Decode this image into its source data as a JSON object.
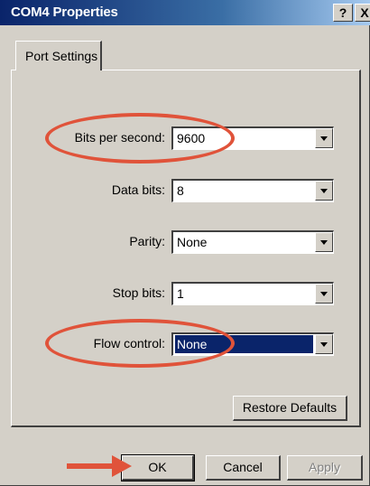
{
  "window": {
    "title": "COM4 Properties",
    "help_button": "?",
    "close_button": "X"
  },
  "tabs": [
    {
      "label": "Port Settings"
    }
  ],
  "settings": {
    "bits_per_second": {
      "label": "Bits per second:",
      "value": "9600"
    },
    "data_bits": {
      "label": "Data bits:",
      "value": "8"
    },
    "parity": {
      "label": "Parity:",
      "value": "None"
    },
    "stop_bits": {
      "label": "Stop bits:",
      "value": "1"
    },
    "flow_control": {
      "label": "Flow control:",
      "value": "None"
    }
  },
  "buttons": {
    "restore_defaults": "Restore Defaults",
    "ok": "OK",
    "cancel": "Cancel",
    "apply": "Apply"
  },
  "annotations": {
    "highlight_color": "#e0533a"
  }
}
